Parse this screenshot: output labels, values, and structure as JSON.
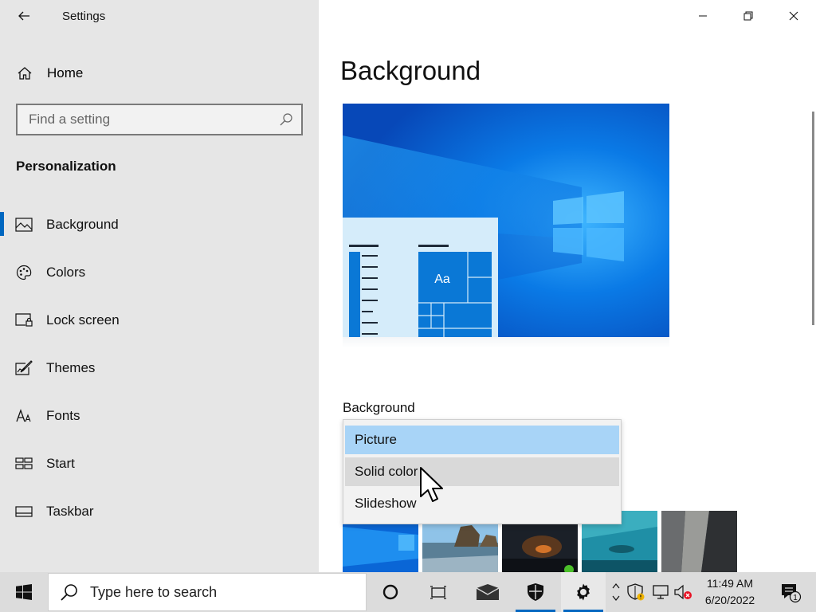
{
  "window": {
    "title": "Settings"
  },
  "sidebar": {
    "home_label": "Home",
    "search_placeholder": "Find a setting",
    "section_title": "Personalization",
    "items": [
      {
        "label": "Background",
        "icon": "picture-icon",
        "active": true
      },
      {
        "label": "Colors",
        "icon": "palette-icon",
        "active": false
      },
      {
        "label": "Lock screen",
        "icon": "lock-screen-icon",
        "active": false
      },
      {
        "label": "Themes",
        "icon": "themes-icon",
        "active": false
      },
      {
        "label": "Fonts",
        "icon": "fonts-icon",
        "active": false
      },
      {
        "label": "Start",
        "icon": "start-icon",
        "active": false
      },
      {
        "label": "Taskbar",
        "icon": "taskbar-icon",
        "active": false
      }
    ]
  },
  "main": {
    "page_title": "Background",
    "preview": {
      "tile_text": "Aa"
    },
    "background_label": "Background",
    "dropdown": {
      "options": [
        "Picture",
        "Solid color",
        "Slideshow"
      ],
      "selected": "Picture",
      "hovered": "Solid color"
    }
  },
  "taskbar": {
    "search_placeholder": "Type here to search",
    "time": "11:49 AM",
    "date": "6/20/2022",
    "notification_count": "1"
  },
  "colors": {
    "accent": "#0067c0",
    "sidebar_bg": "#e6e6e6",
    "dropdown_selected": "#a8d4f7",
    "dropdown_hover": "#d9d9d9",
    "taskbar_bg": "#dcdcdc"
  }
}
